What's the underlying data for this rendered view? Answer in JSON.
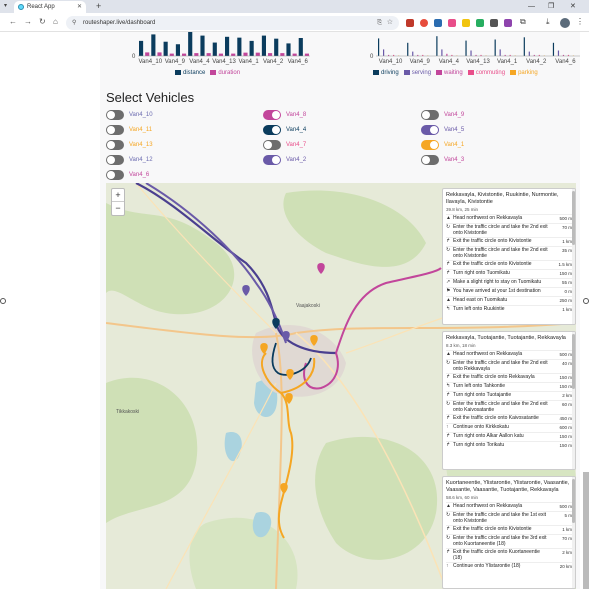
{
  "browser": {
    "tab_title": "React App",
    "url": "routeshaper.live/dashboard",
    "new_tab": "+",
    "menu": "▾",
    "win_min": "—",
    "win_max": "❐",
    "win_close": "✕"
  },
  "charts": {
    "left": {
      "ticks": [
        "Van4_10",
        "Van4_9",
        "Van4_4",
        "Van4_13",
        "Van4_1",
        "Van4_2",
        "Van4_6"
      ],
      "y_tick": "0",
      "legend": [
        {
          "label": "distance",
          "color": "#0b3c5d"
        },
        {
          "label": "duration",
          "color": "#c2469b"
        }
      ]
    },
    "right": {
      "ticks": [
        "Van4_10",
        "Van4_9",
        "Van4_4",
        "Van4_13",
        "Van4_1",
        "Van4_2",
        "Van4_6"
      ],
      "y_tick": "0",
      "legend": [
        {
          "label": "driving",
          "color": "#0b3c5d"
        },
        {
          "label": "serving",
          "color": "#6a5aa8"
        },
        {
          "label": "waiting",
          "color": "#c2469b"
        },
        {
          "label": "commuting",
          "color": "#e84e8a"
        },
        {
          "label": "parking",
          "color": "#f5a623"
        }
      ]
    }
  },
  "chart_data": [
    {
      "type": "bar",
      "categories": [
        "Van4_10",
        "Van4_9",
        "Van4_4",
        "Van4_13",
        "Van4_1",
        "Van4_2",
        "Van4_6"
      ],
      "series": [
        {
          "name": "distance",
          "values": [
            0.9,
            0.7,
            1.0,
            0.8,
            0.9,
            0.85,
            0.75
          ]
        },
        {
          "name": "duration",
          "values": [
            0.15,
            0.1,
            0.12,
            0.1,
            0.14,
            0.12,
            0.1
          ]
        }
      ]
    },
    {
      "type": "bar",
      "categories": [
        "Van4_10",
        "Van4_9",
        "Van4_4",
        "Van4_13",
        "Van4_1",
        "Van4_2",
        "Van4_6"
      ],
      "series": [
        {
          "name": "driving",
          "values": [
            0.8,
            0.6,
            0.9,
            0.7,
            0.75,
            0.85,
            0.6
          ]
        },
        {
          "name": "serving",
          "values": [
            0.3,
            0.2,
            0.3,
            0.25,
            0.3,
            0.2,
            0.25
          ]
        },
        {
          "name": "waiting",
          "values": [
            0.05,
            0.05,
            0.1,
            0.05,
            0.05,
            0.05,
            0.05
          ]
        },
        {
          "name": "commuting",
          "values": [
            0.05,
            0.05,
            0.05,
            0.05,
            0.05,
            0.05,
            0.05
          ]
        },
        {
          "name": "parking",
          "values": [
            0.02,
            0.02,
            0.02,
            0.02,
            0.02,
            0.02,
            0.02
          ]
        }
      ]
    }
  ],
  "select_title": "Select Vehicles",
  "vehicles": [
    {
      "label": "Van4_10",
      "color": "#6b6bb0",
      "on": false,
      "col": 0,
      "row": 0
    },
    {
      "label": "Van4_8",
      "color": "#c2469b",
      "on": true,
      "col": 1,
      "row": 0
    },
    {
      "label": "Van4_9",
      "color": "#c2469b",
      "on": false,
      "col": 2,
      "row": 0
    },
    {
      "label": "Van4_11",
      "color": "#f5a623",
      "on": false,
      "col": 0,
      "row": 1
    },
    {
      "label": "Van4_4",
      "color": "#0b3c5d",
      "on": true,
      "col": 1,
      "row": 1
    },
    {
      "label": "Van4_5",
      "color": "#6a5aa8",
      "on": true,
      "col": 2,
      "row": 1
    },
    {
      "label": "Van4_13",
      "color": "#f5a623",
      "on": false,
      "col": 0,
      "row": 2
    },
    {
      "label": "Van4_7",
      "color": "#e84e8a",
      "on": false,
      "col": 1,
      "row": 2
    },
    {
      "label": "Van4_1",
      "color": "#f5a623",
      "on": true,
      "col": 2,
      "row": 2
    },
    {
      "label": "Van4_12",
      "color": "#6b6bb0",
      "on": false,
      "col": 0,
      "row": 3
    },
    {
      "label": "Van4_2",
      "color": "#6a5aa8",
      "on": true,
      "col": 1,
      "row": 3
    },
    {
      "label": "Van4_3",
      "color": "#c2469b",
      "on": false,
      "col": 2,
      "row": 3
    },
    {
      "label": "Van4_6",
      "color": "#c2469b",
      "on": false,
      "col": 0,
      "row": 4
    }
  ],
  "map": {
    "zoom_in": "+",
    "zoom_out": "−",
    "place_labels": [
      {
        "text": "Tikkakoski",
        "key": "a"
      },
      {
        "text": "Vaajakoski",
        "key": "b"
      }
    ]
  },
  "panels": [
    {
      "title": "Rekkavayla, Kivistontie, Ruukintie, Nurmontie, Ilavayla, Kivistontie",
      "summary": "39.8 km, 25 min",
      "steps": [
        {
          "icon": "▲",
          "text": "Head northwest on Rekkavayla",
          "dist": "500 m"
        },
        {
          "icon": "↻",
          "text": "Enter the traffic circle and take the 2nd exit onto Kivistontie",
          "dist": "70 m"
        },
        {
          "icon": "↱",
          "text": "Exit the traffic circle onto Kivistontie",
          "dist": "1 km"
        },
        {
          "icon": "↻",
          "text": "Enter the traffic circle and take the 2nd exit onto Kivistontie",
          "dist": "35 m"
        },
        {
          "icon": "↱",
          "text": "Exit the traffic circle onto Kivistontie",
          "dist": "1.5 km"
        },
        {
          "icon": "↱",
          "text": "Turn right onto Tuomikatu",
          "dist": "150 m"
        },
        {
          "icon": "↗",
          "text": "Make a slight right to stay on Tuomikatu",
          "dist": "55 m"
        },
        {
          "icon": "⚑",
          "text": "You have arrived at your 1st destination",
          "dist": "0 m"
        },
        {
          "icon": "▲",
          "text": "Head east on Tuomikatu",
          "dist": "250 m"
        },
        {
          "icon": "↰",
          "text": "Turn left onto Ruukintie",
          "dist": "1 km"
        }
      ]
    },
    {
      "title": "Rekkavayla, Tuotajantie, Tuotajantie, Rekkavayla",
      "summary": "8.3 km, 18 min",
      "steps": [
        {
          "icon": "▲",
          "text": "Head northwest on Rekkavayla",
          "dist": "500 m"
        },
        {
          "icon": "↻",
          "text": "Enter the traffic circle and take the 2nd exit onto Rekkavayla",
          "dist": "40 m"
        },
        {
          "icon": "↱",
          "text": "Exit the traffic circle onto Rekkavayla",
          "dist": "150 m"
        },
        {
          "icon": "↰",
          "text": "Turn left onto Tahkontie",
          "dist": "150 m"
        },
        {
          "icon": "↱",
          "text": "Turn right onto Tuotajantie",
          "dist": "2 km"
        },
        {
          "icon": "↻",
          "text": "Enter the traffic circle and take the 2nd exit onto Kaivosatantie",
          "dist": "60 m"
        },
        {
          "icon": "↱",
          "text": "Exit the traffic circle onto Kaivosatantie",
          "dist": "450 m"
        },
        {
          "icon": "↑",
          "text": "Continue onto Kirkkokatu",
          "dist": "600 m"
        },
        {
          "icon": "↱",
          "text": "Turn right onto Alkar Aallon katu",
          "dist": "150 m"
        },
        {
          "icon": "↱",
          "text": "Turn right onto Torikatu",
          "dist": "150 m"
        }
      ]
    },
    {
      "title": "Kuortaneentie, Ylistarontie, Ylistarontie, Vaasantie, Vaasantie, Vaasantie, Tuotajantie, Rekkavayla",
      "summary": "58.6 km, 60 min",
      "steps": [
        {
          "icon": "▲",
          "text": "Head northwest on Rekkavayla",
          "dist": "500 m"
        },
        {
          "icon": "↻",
          "text": "Enter the traffic circle and take the 1st exit onto Kivistontie",
          "dist": "5 m"
        },
        {
          "icon": "↱",
          "text": "Exit the traffic circle onto Kivistontie",
          "dist": "1 km"
        },
        {
          "icon": "↻",
          "text": "Enter the traffic circle and take the 3rd exit onto Kuortaneentie (18)",
          "dist": "70 m"
        },
        {
          "icon": "↱",
          "text": "Exit the traffic circle onto Kuortaneentie (18)",
          "dist": "2 km"
        },
        {
          "icon": "↑",
          "text": "Continue onto Ylistarontie (18)",
          "dist": "20 km"
        }
      ]
    }
  ]
}
